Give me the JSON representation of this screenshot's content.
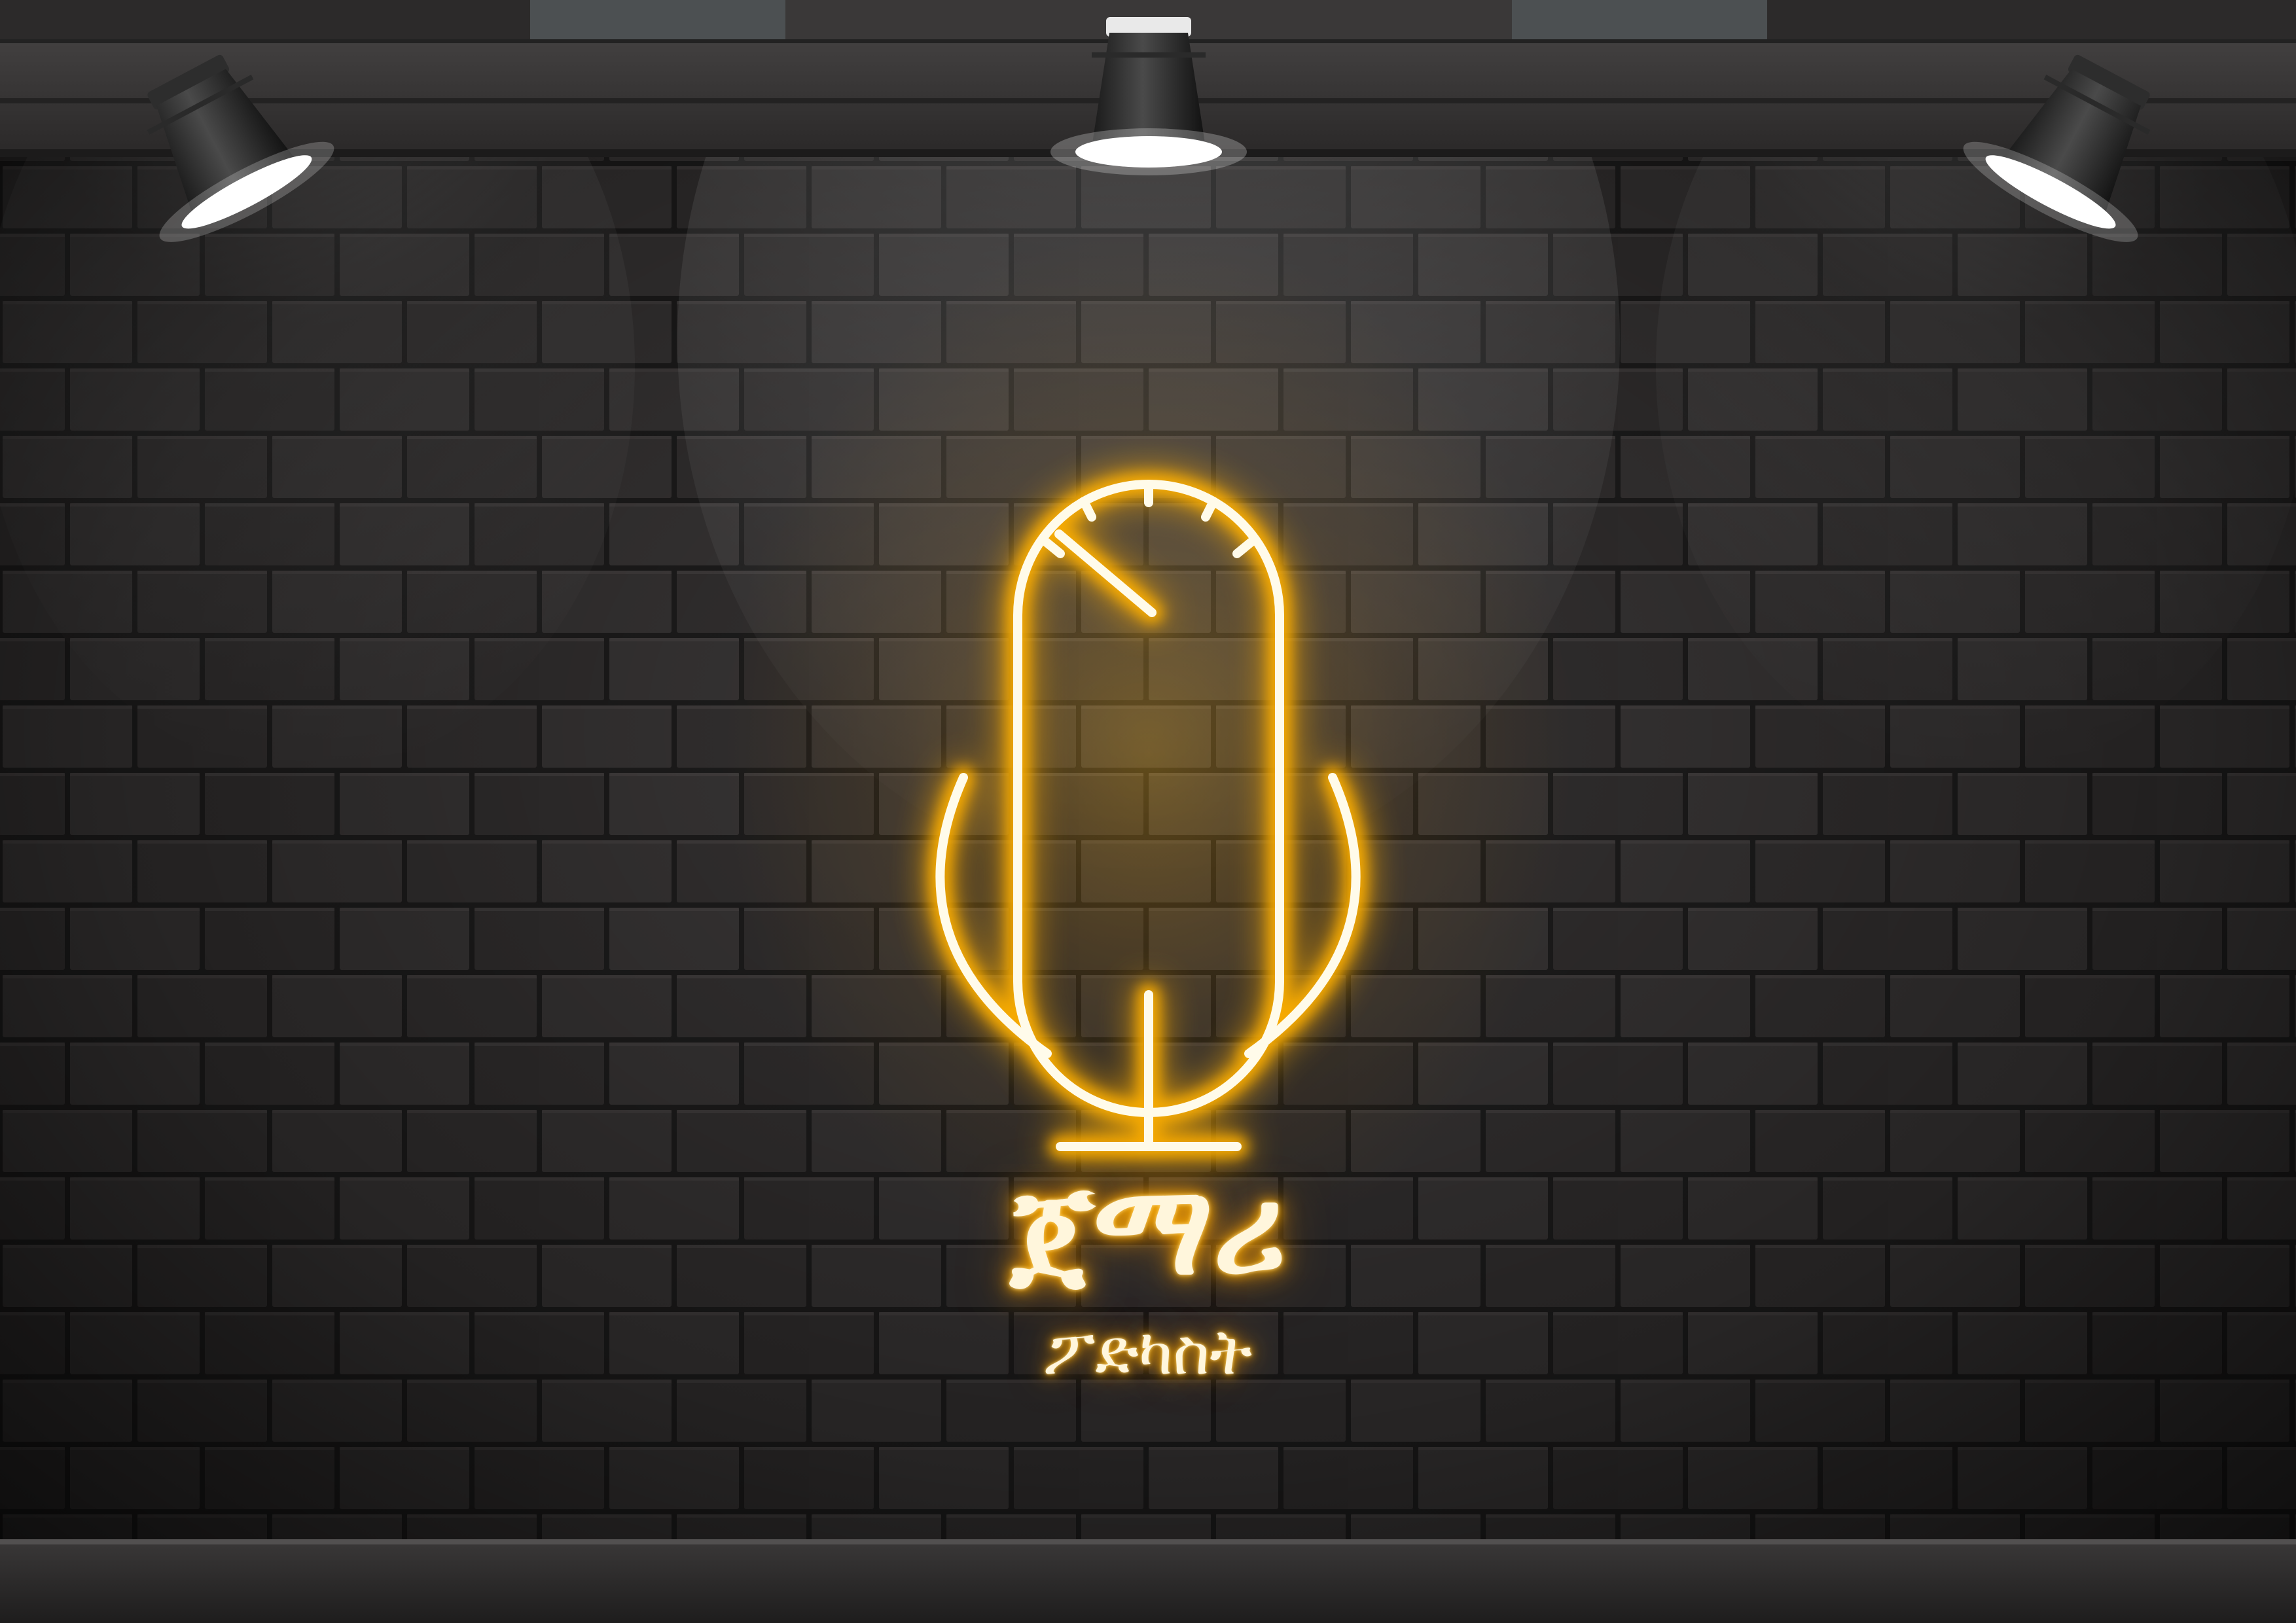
{
  "logo": {
    "title": "ጀማሪ",
    "subtitle": "ፖድካስት"
  },
  "colors": {
    "wall": "#2d2b2b",
    "brick": "#3a3737",
    "mortar": "#1f1e1e",
    "ceiling": "#3e3c3c",
    "floor": "#2b2a2a",
    "neon_core": "#fffbea",
    "neon_glow": "#ffb000"
  },
  "icons": [
    "microphone-icon",
    "spotlight-icon"
  ]
}
